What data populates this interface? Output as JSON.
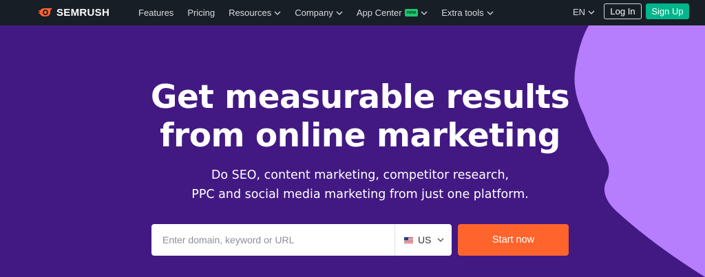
{
  "nav": {
    "logo_text": "SEMRUSH",
    "items": [
      {
        "label": "Features",
        "has_dropdown": false,
        "badge": ""
      },
      {
        "label": "Pricing",
        "has_dropdown": false,
        "badge": ""
      },
      {
        "label": "Resources",
        "has_dropdown": true,
        "badge": ""
      },
      {
        "label": "Company",
        "has_dropdown": true,
        "badge": ""
      },
      {
        "label": "App Center",
        "has_dropdown": true,
        "badge": "new"
      },
      {
        "label": "Extra tools",
        "has_dropdown": true,
        "badge": ""
      }
    ],
    "language": "EN",
    "login_label": "Log In",
    "signup_label": "Sign Up"
  },
  "hero": {
    "headline_line1": "Get measurable results",
    "headline_line2": "from online marketing",
    "subhead_line1": "Do SEO, content marketing, competitor research,",
    "subhead_line2": "PPC and social media marketing from just one platform."
  },
  "search": {
    "placeholder": "Enter domain, keyword or URL",
    "value": "",
    "database": "US",
    "button_label": "Start now"
  },
  "colors": {
    "nav_bg": "#181e25",
    "hero_bg": "#421983",
    "accent_shape": "#b67efc",
    "signup_bg": "#00b58c",
    "start_bg": "#ff642d"
  },
  "icons": [
    "semrush-flame-logo",
    "chevron-down-icon",
    "us-flag-icon"
  ]
}
